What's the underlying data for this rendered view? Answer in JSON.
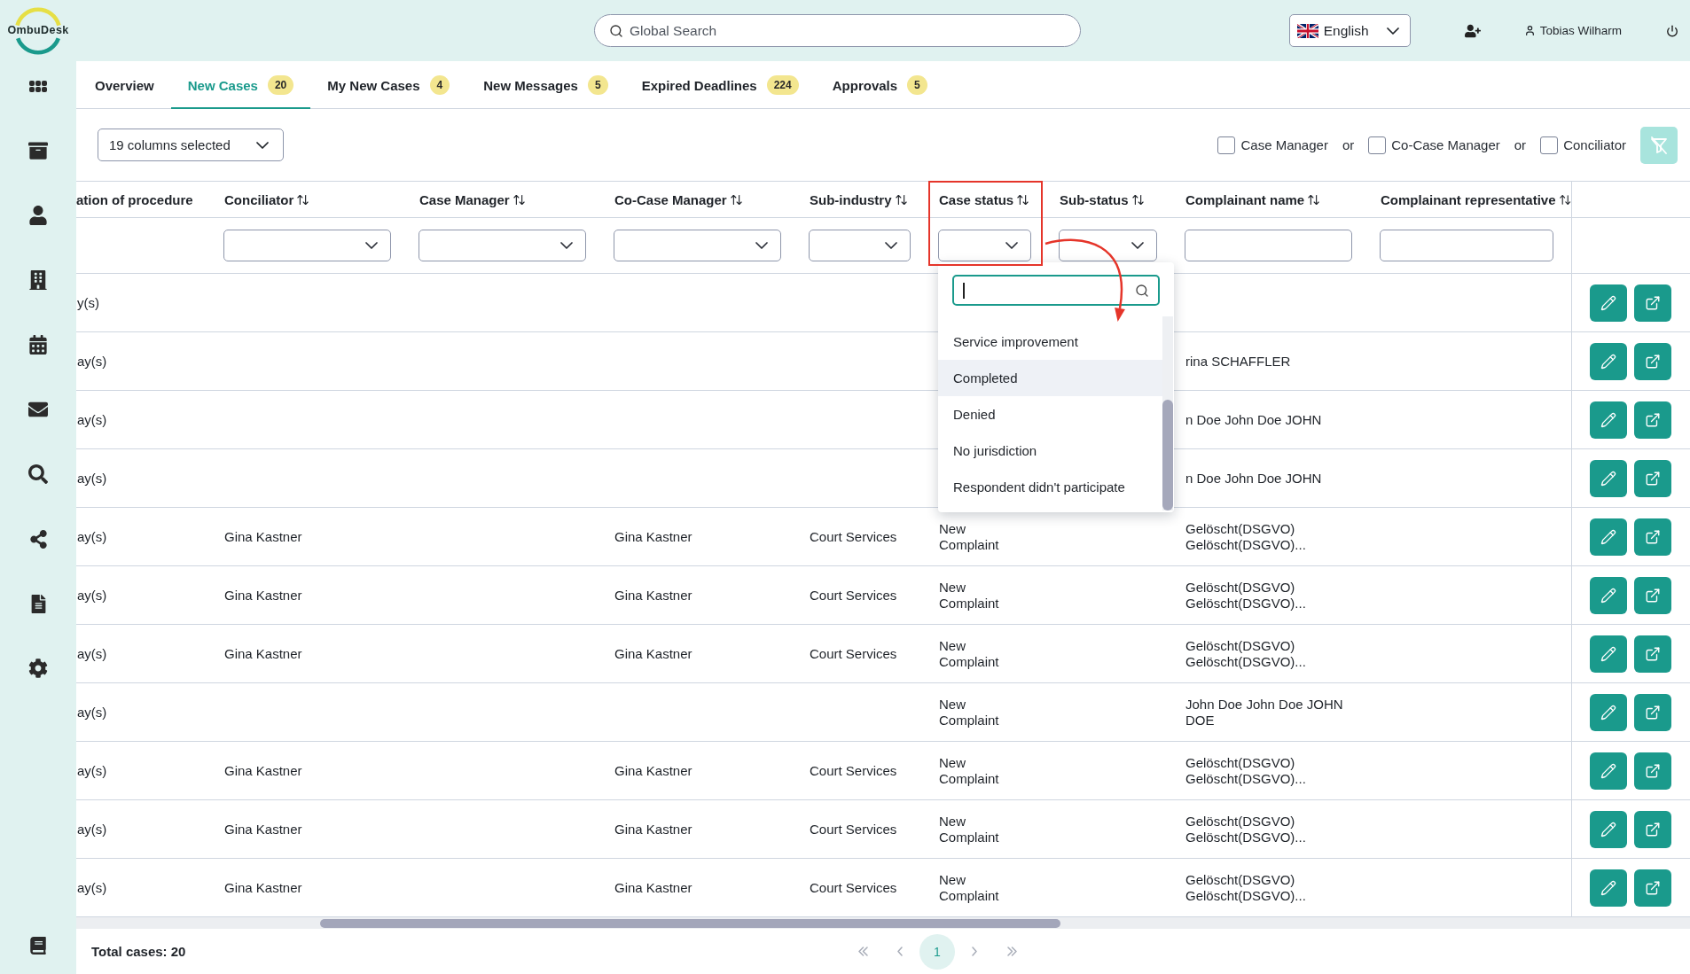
{
  "header": {
    "logo": "OmbuDesk",
    "search": {
      "placeholder": "Global Search"
    },
    "language": {
      "value": "English"
    },
    "user": {
      "name": "Tobias Wilharm"
    }
  },
  "tabs": [
    {
      "label": "Overview",
      "selected": false
    },
    {
      "label": "New Cases",
      "count": "20",
      "selected": true
    },
    {
      "label": "My New Cases",
      "count": "4",
      "selected": false
    },
    {
      "label": "New Messages",
      "count": "5",
      "selected": false
    },
    {
      "label": "Expired Deadlines",
      "count": "224",
      "selected": false
    },
    {
      "label": "Approvals",
      "count": "5",
      "selected": false
    }
  ],
  "toolbar": {
    "columns_select": {
      "value": "19 columns selected"
    },
    "filters": [
      {
        "kind": "checkbox",
        "label": "Case Manager",
        "checked": false
      },
      {
        "kind": "separator",
        "label": "or"
      },
      {
        "kind": "checkbox",
        "label": "Co-Case Manager",
        "checked": false
      },
      {
        "kind": "separator",
        "label": "or"
      },
      {
        "kind": "checkbox",
        "label": "Conciliator",
        "checked": false
      }
    ],
    "filter_button": {
      "disabled": true
    }
  },
  "table": {
    "columns": [
      {
        "label": "ation of procedure",
        "sortable": false,
        "annotated": false,
        "filter": {
          "kind": "none"
        }
      },
      {
        "label": "Conciliator",
        "sortable": true,
        "annotated": false,
        "filter": {
          "kind": "select",
          "open": false
        }
      },
      {
        "label": "Case Manager",
        "sortable": true,
        "annotated": false,
        "filter": {
          "kind": "select",
          "open": false
        }
      },
      {
        "label": "Co-Case Manager",
        "sortable": true,
        "annotated": false,
        "filter": {
          "kind": "select",
          "open": false
        }
      },
      {
        "label": "Sub-industry",
        "sortable": true,
        "annotated": false,
        "filter": {
          "kind": "select",
          "open": false
        }
      },
      {
        "label": "Case status",
        "sortable": true,
        "annotated": true,
        "filter": {
          "kind": "select",
          "open": true,
          "options": [
            {
              "label": "Service improvement",
              "selected": false
            },
            {
              "label": "Completed",
              "selected": true
            },
            {
              "label": "Denied",
              "selected": false
            },
            {
              "label": "No jurisdiction",
              "selected": false
            },
            {
              "label": "Respondent didn't participate",
              "selected": false
            }
          ]
        }
      },
      {
        "label": "Sub-status",
        "sortable": true,
        "annotated": false,
        "filter": {
          "kind": "select",
          "open": false
        }
      },
      {
        "label": "Complainant name",
        "sortable": true,
        "annotated": false,
        "filter": {
          "kind": "text"
        }
      },
      {
        "label": "Complainant representative",
        "sortable": true,
        "annotated": false,
        "filter": {
          "kind": "text"
        }
      }
    ],
    "rows": [
      {
        "column_1": "y(s)"
      },
      {
        "column_1": "ay(s)",
        "complainant_name": "rina SCHAFFLER"
      },
      {
        "column_1": "ay(s)",
        "complainant_name": "n Doe John Doe JOHN"
      },
      {
        "column_1": "ay(s)",
        "complainant_name": "n Doe John Doe JOHN"
      },
      {
        "column_1": "ay(s)",
        "conciliator": "Gina Kastner",
        "co_case_manager": "Gina Kastner",
        "sub_industry": "Court Services",
        "case_status": "New Complaint",
        "complainant_name": "Gelöscht(DSGVO) Gelöscht(DSGVO)..."
      },
      {
        "column_1": "ay(s)",
        "conciliator": "Gina Kastner",
        "co_case_manager": "Gina Kastner",
        "sub_industry": "Court Services",
        "case_status": "New Complaint",
        "complainant_name": "Gelöscht(DSGVO) Gelöscht(DSGVO)..."
      },
      {
        "column_1": "ay(s)",
        "conciliator": "Gina Kastner",
        "co_case_manager": "Gina Kastner",
        "sub_industry": "Court Services",
        "case_status": "New Complaint",
        "complainant_name": "Gelöscht(DSGVO) Gelöscht(DSGVO)..."
      },
      {
        "column_1": "ay(s)",
        "case_status": "New Complaint",
        "complainant_name": "John Doe John Doe JOHN DOE"
      },
      {
        "column_1": "ay(s)",
        "conciliator": "Gina Kastner",
        "co_case_manager": "Gina Kastner",
        "sub_industry": "Court Services",
        "case_status": "New Complaint",
        "complainant_name": "Gelöscht(DSGVO) Gelöscht(DSGVO)..."
      },
      {
        "column_1": "ay(s)",
        "conciliator": "Gina Kastner",
        "co_case_manager": "Gina Kastner",
        "sub_industry": "Court Services",
        "case_status": "New Complaint",
        "complainant_name": "Gelöscht(DSGVO) Gelöscht(DSGVO)..."
      },
      {
        "column_1": "ay(s)",
        "conciliator": "Gina Kastner",
        "co_case_manager": "Gina Kastner",
        "sub_industry": "Court Services",
        "case_status": "New Complaint",
        "complainant_name": "Gelöscht(DSGVO) Gelöscht(DSGVO)..."
      }
    ]
  },
  "footer": {
    "total": "Total cases: 20",
    "pagination": {
      "nav_disabled": true,
      "pages": [
        {
          "label": "1",
          "selected": true
        }
      ]
    }
  }
}
